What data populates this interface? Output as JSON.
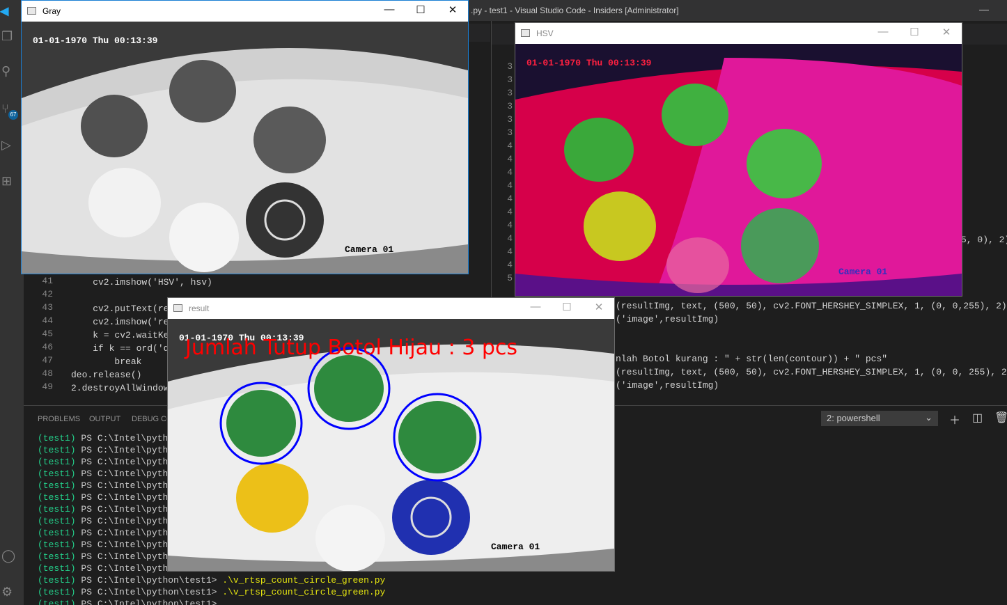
{
  "vscode": {
    "title": ".py - test1 - Visual Studio Code - Insiders [Administrator]",
    "scm_badge": "67",
    "left_lines": [
      {
        "n": "41",
        "code": "    cv2.imshow('HSV', hsv)"
      },
      {
        "n": "42",
        "code": ""
      },
      {
        "n": "43",
        "code": "    cv2.putText(resu"
      },
      {
        "n": "44",
        "code": "    cv2.imshow('resu"
      },
      {
        "n": "45",
        "code": "    k = cv2.waitKey("
      },
      {
        "n": "46",
        "code": "    if k == ord('q')"
      },
      {
        "n": "47",
        "code": "        break"
      },
      {
        "n": "48",
        "code": "deo.release()"
      },
      {
        "n": "49",
        "code": "2.destroyAllWindow"
      }
    ],
    "right_line_numbers": [
      "3",
      "3",
      "3",
      "3",
      "3",
      "3",
      "4",
      "4",
      "4",
      "4",
      "4",
      "4",
      "4",
      "4",
      "4",
      "4",
      "5"
    ],
    "right_code": [
      "5, 0), 2)",
      "(resultImg, text, (500, 50), cv2.FONT_HERSHEY_SIMPLEX, 1, (0, 0,255), 2)",
      "('image',resultImg)",
      "nlah Botol kurang : \" + str(len(contour)) + \" pcs\"",
      "(resultImg, text, (500, 50), cv2.FONT_HERSHEY_SIMPLEX, 1, (0, 0, 255), 2)",
      "('image',resultImg)"
    ],
    "panel_tabs": [
      "PROBLEMS",
      "OUTPUT",
      "DEBUG CO"
    ],
    "terminal_select": "2: powershell",
    "terminal": {
      "env": "(test1)",
      "prompt_short": "PS C:\\Intel\\python\\",
      "prompt_full": "PS C:\\Intel\\python\\test1>",
      "command": ".\\v_rtsp_count_circle_green.py",
      "short_rows": 12
    }
  },
  "windows": {
    "gray": {
      "title": "Gray",
      "timestamp": "01-01-1970 Thu 00:13:39",
      "camera": "Camera 01"
    },
    "hsv": {
      "title": "HSV",
      "timestamp": "01-01-1970 Thu 00:13:39",
      "camera": "Camera 01"
    },
    "result": {
      "title": "result",
      "timestamp": "01-01-1970 Thu 00:13:39",
      "camera": "Camera 01",
      "count_text": "Jumlah Tutup Botol Hijau : 3 pcs"
    }
  },
  "window_controls": {
    "minimize": "—",
    "maximize": "☐",
    "close": "✕"
  },
  "icons": {
    "min": "minimize-icon",
    "max": "maximize-icon",
    "close": "close-icon"
  }
}
